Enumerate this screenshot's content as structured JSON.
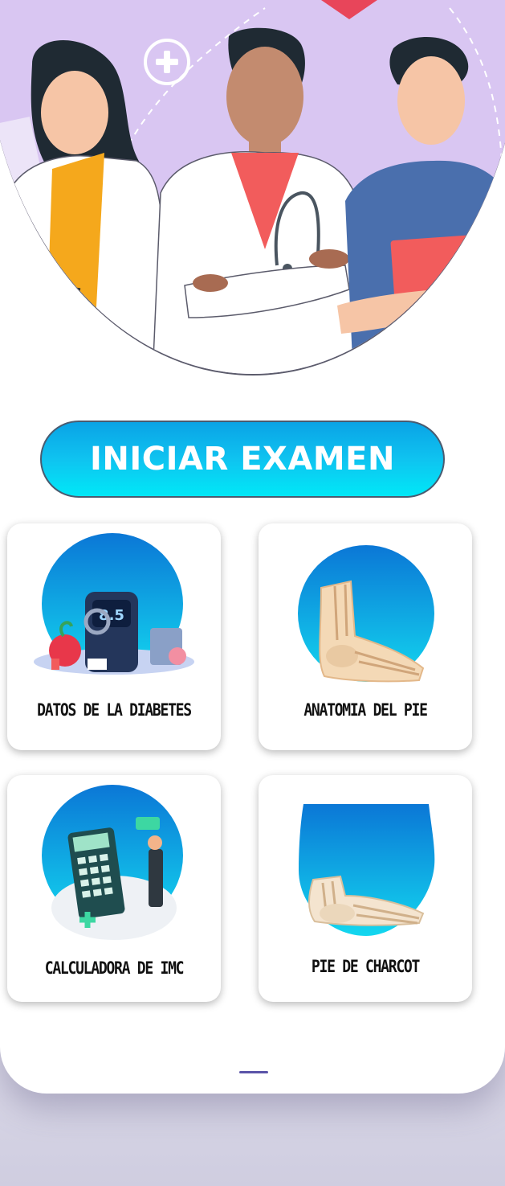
{
  "cta": {
    "label": "INICIAR EXAMEN"
  },
  "cards": [
    {
      "label": "DATOS DE LA DIABETES",
      "icon": "glucometer-illustration",
      "reading": "8.5"
    },
    {
      "label": "ANATOMIA DEL PIE",
      "icon": "foot-bones-illustration"
    },
    {
      "label": "CALCULADORA DE IMC",
      "icon": "calculator-illustration"
    },
    {
      "label": "PIE DE CHARCOT",
      "icon": "charcot-foot-illustration"
    }
  ],
  "colors": {
    "hero_bg": "#d9c6f2",
    "cta_top": "#0aa3e6",
    "cta_bottom": "#00e8f7",
    "circle_top": "#0b77d6",
    "circle_bottom": "#13d7ef"
  }
}
